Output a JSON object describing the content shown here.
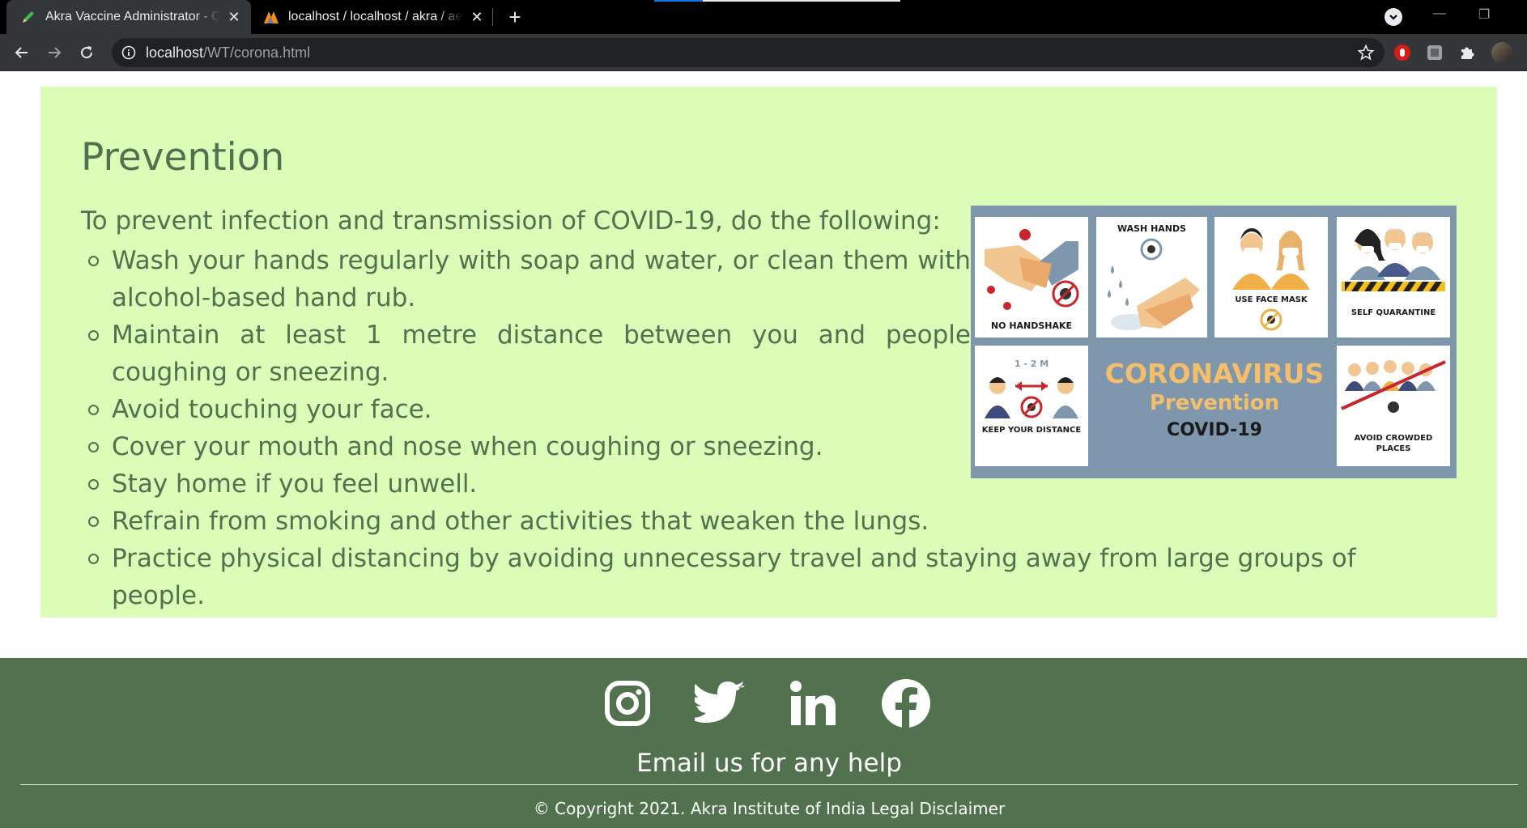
{
  "browser": {
    "tabs": [
      {
        "title": "Akra Vaccine Administrator - Cov",
        "icon": "pencil-icon",
        "active": true
      },
      {
        "title": "localhost / localhost / akra / aefi",
        "icon": "phpmyadmin-icon",
        "active": false
      }
    ],
    "url_host": "localhost",
    "url_path": "/WT/corona.html"
  },
  "prevention": {
    "title": "Prevention",
    "intro": "To prevent infection and transmission of COVID-19, do the following:",
    "items": [
      "Wash your hands regularly with soap and water, or clean them with alcohol-based hand rub.",
      "Maintain at least 1 metre distance between you and people coughing or sneezing.",
      "Avoid touching your face.",
      "Cover your mouth and nose when coughing or sneezing.",
      "Stay home if you feel unwell.",
      "Refrain from smoking and other activities that weaken the lungs.",
      "Practice physical distancing by avoiding unnecessary travel and staying away from large groups of people."
    ],
    "poster": {
      "cells": [
        "NO HANDSHAKE",
        "WASH HANDS",
        "USE FACE MASK",
        "SELF QUARANTINE",
        "1 - 2 M",
        "KEEP YOUR DISTANCE",
        "AVOID CROWDED PLACES"
      ],
      "headline": "CORONAVIRUS",
      "subheadline": "Prevention",
      "tagline": "COVID-19",
      "colors": {
        "frame": "#7f97ac",
        "accent": "#f4be6b",
        "danger": "#c8262b"
      }
    }
  },
  "footer": {
    "social": [
      "instagram-icon",
      "twitter-icon",
      "linkedin-icon",
      "facebook-icon"
    ],
    "help": "Email us for any help",
    "copyright": "© Copyright 2021. Akra Institute of India Legal Disclaimer"
  },
  "colors": {
    "panel": "#dcfdb8",
    "text": "#52714e",
    "footer": "#52714e"
  }
}
